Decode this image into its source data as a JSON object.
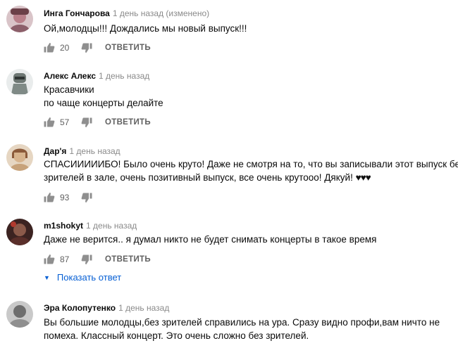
{
  "labels": {
    "reply": "ОТВЕТИТЬ",
    "show_replies": "Показать ответ"
  },
  "comments": [
    {
      "author": "Инга Гончарова",
      "time": "1 день назад (изменено)",
      "lines": [
        "Ой,молодцы!!! Дождались мы новый выпуск!!!"
      ],
      "likes": "20",
      "avatar_color": "#b9808a"
    },
    {
      "author": "Алекс Алекс",
      "time": "1 день назад",
      "lines": [
        "Красавчики",
        "по чаще концерты делайте"
      ],
      "likes": "57",
      "avatar_color": "#7f8a86"
    },
    {
      "author": "Дар'я",
      "time": "1 день назад",
      "lines": [
        "СПАСИИИИИБО! Было очень круто! Даже не смотря на то, что вы записывали этот выпуск без",
        "зрителей в зале, очень позитивный выпуск, все очень крутоoo! Дякуй!"
      ],
      "hearts": "♥♥♥",
      "likes": "93",
      "avatar_color": "#c7a27a"
    },
    {
      "author": "m1shokyt",
      "time": "1 день назад",
      "lines": [
        "Даже не верится.. я думал никто не будет снимать концерты в такое время"
      ],
      "likes": "87",
      "avatar_color": "#5a2f2a"
    },
    {
      "author": "Эра Колопутенко",
      "time": "1 день назад",
      "lines": [
        "Вы большие молодцы,без зрителей справились на ура. Сразу видно профи,вам ничто не",
        "помеха. Классный концерт. Это очень сложно без зрителей."
      ],
      "avatar_color": "#8f8f8f"
    }
  ]
}
